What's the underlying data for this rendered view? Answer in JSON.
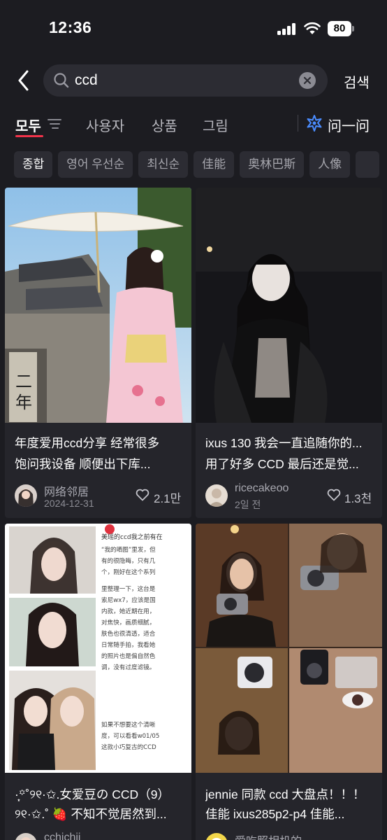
{
  "status": {
    "time": "12:36",
    "battery": "80"
  },
  "search": {
    "query": "ccd",
    "submit_label": "검색"
  },
  "tabs": [
    "모두",
    "사용자",
    "상품",
    "그림"
  ],
  "ai_tab_label": "问一问",
  "chips": [
    "종합",
    "영어 우선순",
    "최신순",
    "佳能",
    "奥林巴斯",
    "人像"
  ],
  "posts": [
    {
      "title_line1": "年度爱用ccd分享 经常很多",
      "title_line2": "饱问我设备 顺便出下库...",
      "author": "网络邻居",
      "date": "2024-12-31",
      "likes": "2.1만"
    },
    {
      "title_line1": "ixus 130 我会一直追随你的...",
      "title_line2": "用了好多 CCD 最后还是觉...",
      "author": "ricecakeoo",
      "date": "2일 전",
      "likes": "1.3천"
    },
    {
      "title_line1": "·̩͙꙳˚୨୧·✩.女爱豆の CCD（9）",
      "title_line2": "୨୧·✩.˚ 🍓 不知不觉居然到...",
      "author": "cchichii",
      "note_heading": "美瑶的ccd我之前有在",
      "note_lines": [
        "“我的晒图”里发，但",
        "有的很隐晦，只有几",
        "个，刚好在这个系列",
        "里整理一下，这台是",
        "索尼wx7，应该是国",
        "内款，她近期在用，",
        "对焦快，画质细腻，",
        "肤色也很清透，适合",
        "日常随手拍，我看她",
        "的照片也是偏自然色",
        "调，没有过度滤镜。",
        "如果不想要这个清晰",
        "度，可以看看w01/05",
        "这款小巧复古的CCD"
      ]
    },
    {
      "title_line1": "jennie 同款 ccd 大盘点！！！",
      "title_line2": "佳能 ixus285p2-p4 佳能...",
      "author": "爱吃照相机的"
    }
  ]
}
